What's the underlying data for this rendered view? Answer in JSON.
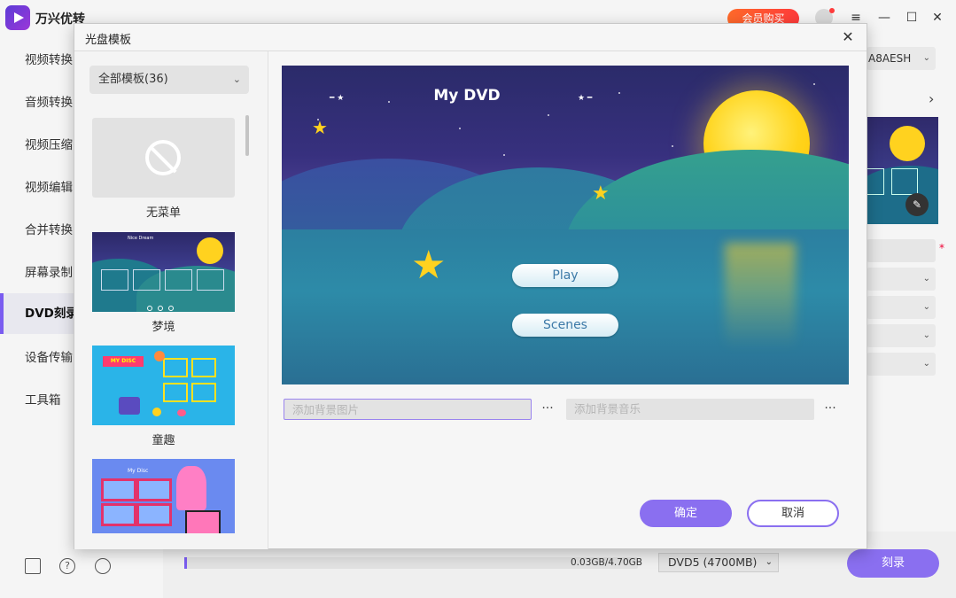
{
  "app": {
    "title": "万兴优转",
    "vip_label": "会员购买"
  },
  "sidebar": {
    "items": [
      {
        "label": "视频转换"
      },
      {
        "label": "音频转换"
      },
      {
        "label": "视频压缩"
      },
      {
        "label": "视频编辑"
      },
      {
        "label": "合并转换"
      },
      {
        "label": "屏幕录制"
      },
      {
        "label": "DVD刻录"
      },
      {
        "label": "设备传输"
      },
      {
        "label": "工具箱"
      }
    ],
    "active_index": 6,
    "footer_icons": [
      "book-icon",
      "help-icon",
      "users-icon"
    ]
  },
  "right_panel": {
    "device_select": "A8AESH"
  },
  "bottom": {
    "progress_text": "0.03GB/4.70GB",
    "progress_fraction": 0.006,
    "disc_type": "DVD5 (4700MB)",
    "burn_label": "刻录"
  },
  "dialog": {
    "title": "光盘模板",
    "filter": "全部模板(36)",
    "templates": [
      {
        "label": "无菜单"
      },
      {
        "label": "梦境"
      },
      {
        "label": "童趣"
      },
      {
        "label": ""
      }
    ],
    "dream_thumb_title": "Nice Dream",
    "kids_thumb_title": "MY DISC",
    "disc_thumb_title": "My Disc",
    "preview": {
      "title": "My DVD",
      "buttons": [
        "Play",
        "Scenes"
      ]
    },
    "bg_image_placeholder": "添加背景图片",
    "bg_music_placeholder": "添加背景音乐",
    "more_label": "···",
    "ok_label": "确定",
    "cancel_label": "取消"
  }
}
